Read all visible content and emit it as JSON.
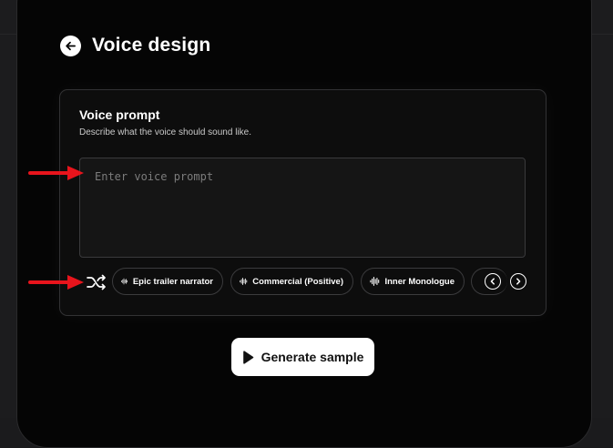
{
  "header": {
    "title": "Voice design",
    "back_icon": "arrow-left-icon"
  },
  "voice_prompt": {
    "title": "Voice prompt",
    "subtitle": "Describe what the voice should sound like.",
    "placeholder": "Enter voice prompt",
    "value": ""
  },
  "presets": [
    {
      "label": "Epic trailer narrator",
      "icon": "waveform-icon"
    },
    {
      "label": "Commercial (Positive)",
      "icon": "waveform-icon"
    },
    {
      "label": "Inner Monologue",
      "icon": "waveform-icon"
    }
  ],
  "controls": {
    "shuffle_icon": "shuffle-icon",
    "prev_icon": "chevron-left-icon",
    "next_icon": "chevron-right-icon"
  },
  "generate": {
    "label": "Generate sample",
    "icon": "play-icon"
  },
  "colors": {
    "accent": "#ffffff",
    "background": "#050505",
    "annotation_arrow": "#e8141c"
  }
}
